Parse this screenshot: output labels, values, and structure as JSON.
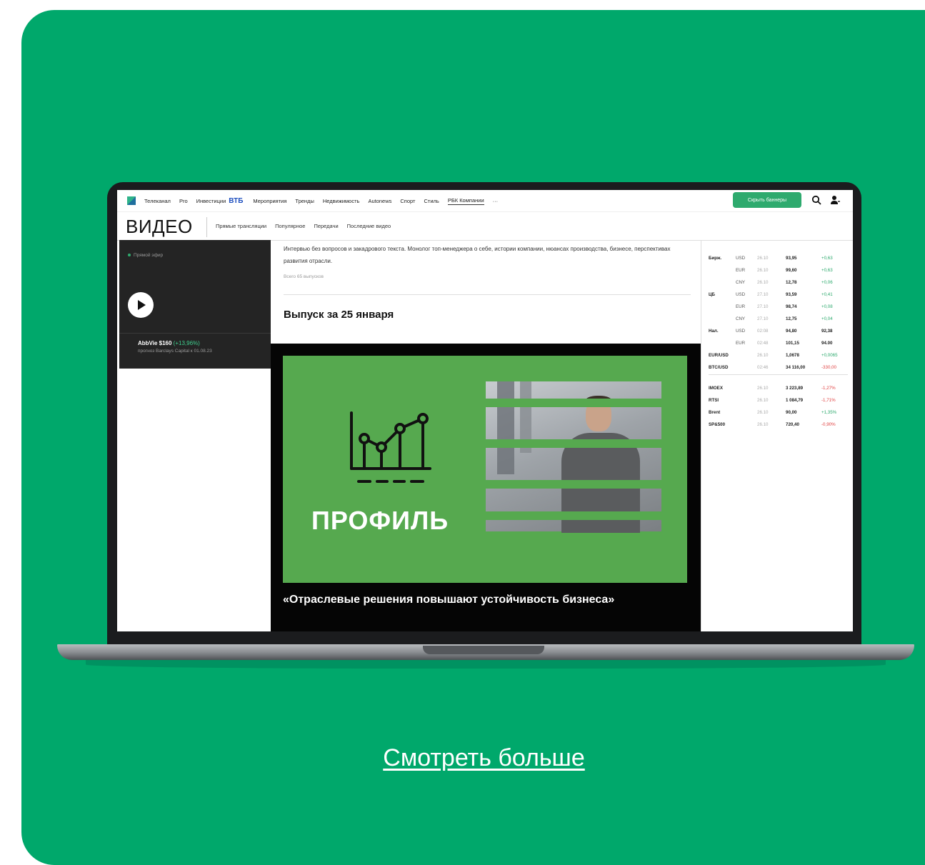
{
  "topnav": {
    "items": [
      "Телеканал",
      "Pro",
      "Инвестиции"
    ],
    "vtb": "ВТБ",
    "items2": [
      "Мероприятия",
      "Тренды",
      "Недвижимость",
      "Autonews",
      "Спорт",
      "Стиль"
    ],
    "active": "РБК Компании",
    "more": "···",
    "hide_banners": "Скрыть баннеры"
  },
  "section": {
    "title": "ВИДЕО",
    "tabs": [
      "Прямые трансляции",
      "Популярное",
      "Передачи",
      "Последние видео"
    ]
  },
  "left": {
    "live_label": "Прямой эфир",
    "ticker_name": "AbbVie $160",
    "ticker_change": "(+13,96%)",
    "ticker_sub": "прогноз Barclays Capital к 01.08.23"
  },
  "main": {
    "description": "Интервью без вопросов и закадрового текста. Монолог топ-менеджера о себе, истории компании, нюансах производства, бизнесе, перспективах развития отрасли.",
    "count": "Всего 65 выпусков",
    "issue_title": "Выпуск за 25 января",
    "video_brand": "ПРОФИЛЬ",
    "video_caption": "«Отраслевые решения повышают устойчивость бизнеса»"
  },
  "rates": [
    {
      "grp": "Бирж.",
      "cur": "USD",
      "dt": "26.10",
      "val": "93,95",
      "chg": "+0,63",
      "dir": "up"
    },
    {
      "grp": "",
      "cur": "EUR",
      "dt": "26.10",
      "val": "99,60",
      "chg": "+0,63",
      "dir": "up"
    },
    {
      "grp": "",
      "cur": "CNY",
      "dt": "26.10",
      "val": "12,78",
      "chg": "+0,06",
      "dir": "up"
    },
    {
      "grp": "ЦБ",
      "cur": "USD",
      "dt": "27.10",
      "val": "93,59",
      "chg": "+0,41",
      "dir": "up"
    },
    {
      "grp": "",
      "cur": "EUR",
      "dt": "27.10",
      "val": "98,74",
      "chg": "+0,08",
      "dir": "up"
    },
    {
      "grp": "",
      "cur": "CNY",
      "dt": "27.10",
      "val": "12,75",
      "chg": "+0,04",
      "dir": "up"
    },
    {
      "grp": "Нал.",
      "cur": "USD",
      "dt": "02:08",
      "val": "94,80",
      "chg": "92,38",
      "dir": "neu"
    },
    {
      "grp": "",
      "cur": "EUR",
      "dt": "02:48",
      "val": "101,15",
      "chg": "94.00",
      "dir": "neu"
    },
    {
      "grp": "EUR/USD",
      "cur": "",
      "dt": "26.10",
      "val": "1,0678",
      "chg": "+0,0065",
      "dir": "up"
    },
    {
      "grp": "BTC/USD",
      "cur": "",
      "dt": "02:46",
      "val": "34 116,00",
      "chg": "-330,00",
      "dir": "dn"
    }
  ],
  "indices": [
    {
      "grp": "IMOEX",
      "dt": "26.10",
      "val": "3 223,89",
      "chg": "-1,27%",
      "dir": "dn"
    },
    {
      "grp": "RTSI",
      "dt": "26.10",
      "val": "1 084,79",
      "chg": "-1,71%",
      "dir": "dn"
    },
    {
      "grp": "Brent",
      "dt": "26.10",
      "val": "90,00",
      "chg": "+1,35%",
      "dir": "up"
    },
    {
      "grp": "SP&500",
      "dt": "26.10",
      "val": "720,40",
      "chg": "-0,90%",
      "dir": "dn"
    }
  ],
  "cta": "Смотреть больше",
  "colors": {
    "background": "#00a86b",
    "accent": "#2eaa6e",
    "video_bg": "#56a94f"
  }
}
